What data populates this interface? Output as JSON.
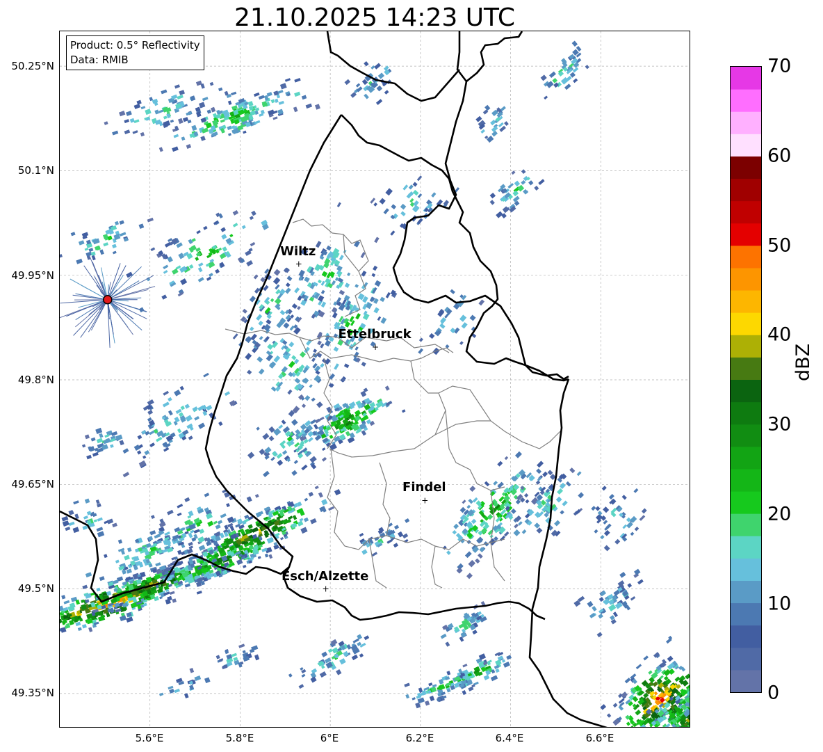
{
  "title": "21.10.2025 14:23 UTC",
  "info_box": {
    "product": "Product: 0.5° Reflectivity",
    "data": "Data: RMIB"
  },
  "map": {
    "extent": {
      "lon": [
        5.4,
        6.8
      ],
      "lat": [
        49.3,
        50.3
      ]
    },
    "lat_ticks": [
      "50.25°N",
      "50.1°N",
      "49.95°N",
      "49.8°N",
      "49.65°N",
      "49.5°N",
      "49.35°N"
    ],
    "lon_ticks": [
      "5.6°E",
      "5.8°E",
      "6°E",
      "6.2°E",
      "6.4°E",
      "6.6°E"
    ],
    "cities": [
      {
        "name": "Wiltz",
        "lon": 5.93,
        "lat": 49.966
      },
      {
        "name": "Ettelbruck",
        "lon": 6.1,
        "lat": 49.847
      },
      {
        "name": "Findel",
        "lon": 6.21,
        "lat": 49.627
      },
      {
        "name": "Esch/Alzette",
        "lon": 5.99,
        "lat": 49.5
      }
    ],
    "radar_site": {
      "lon": 5.506,
      "lat": 49.915
    },
    "colors": {
      "border": "#000000",
      "canton": "#808080",
      "grid": "#b0b0b0",
      "radar_site": "#e41a1c"
    }
  },
  "colorbar": {
    "label": "dBZ",
    "min": 0,
    "max": 70,
    "ticks": [
      "0",
      "10",
      "20",
      "30",
      "40",
      "50",
      "60",
      "70"
    ],
    "colors": [
      "#6373a8",
      "#506aa6",
      "#425ea1",
      "#4c79b2",
      "#5a9bc6",
      "#66c0dc",
      "#5cd5c4",
      "#3fd46d",
      "#16c91d",
      "#14b617",
      "#12a414",
      "#118d12",
      "#0e7b10",
      "#0b6410",
      "#477a12",
      "#adb005",
      "#fdd800",
      "#fdb600",
      "#fd9500",
      "#fd7300",
      "#e40000",
      "#c00000",
      "#a00000",
      "#7c0000",
      "#ffe0ff",
      "#ffb0ff",
      "#ff6eff",
      "#e638e6"
    ]
  }
}
